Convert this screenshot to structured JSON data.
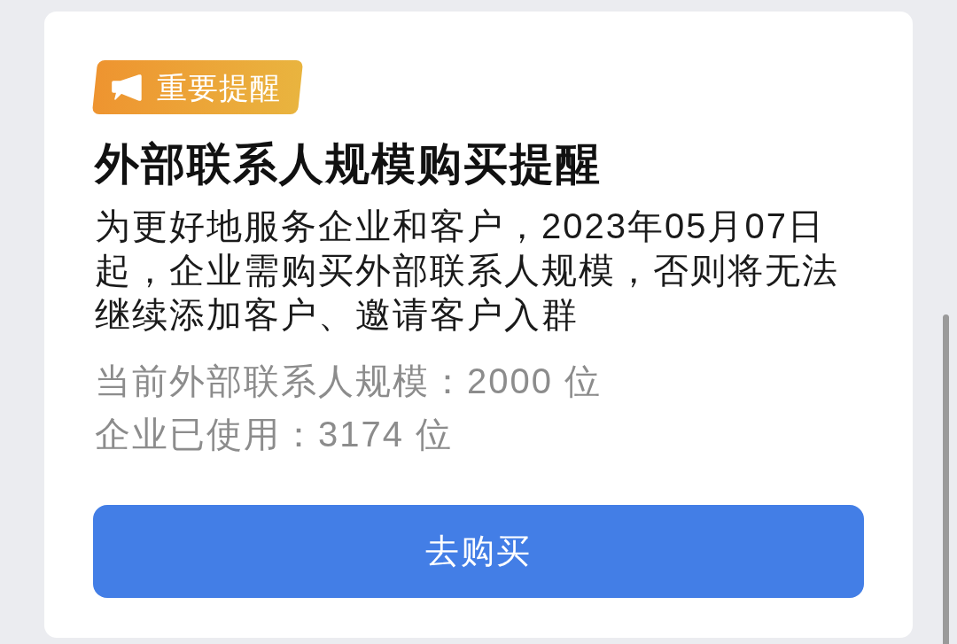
{
  "badge": {
    "label": "重要提醒"
  },
  "title": "外部联系人规模购买提醒",
  "message": "为更好地服务企业和客户，2023年05月07日起，企业需购买外部联系人规模，否则将无法继续添加客户、邀请客户入群",
  "details": [
    "当前外部联系人规模：2000 位",
    "企业已使用：3174 位"
  ],
  "button": {
    "label": "去购买"
  }
}
